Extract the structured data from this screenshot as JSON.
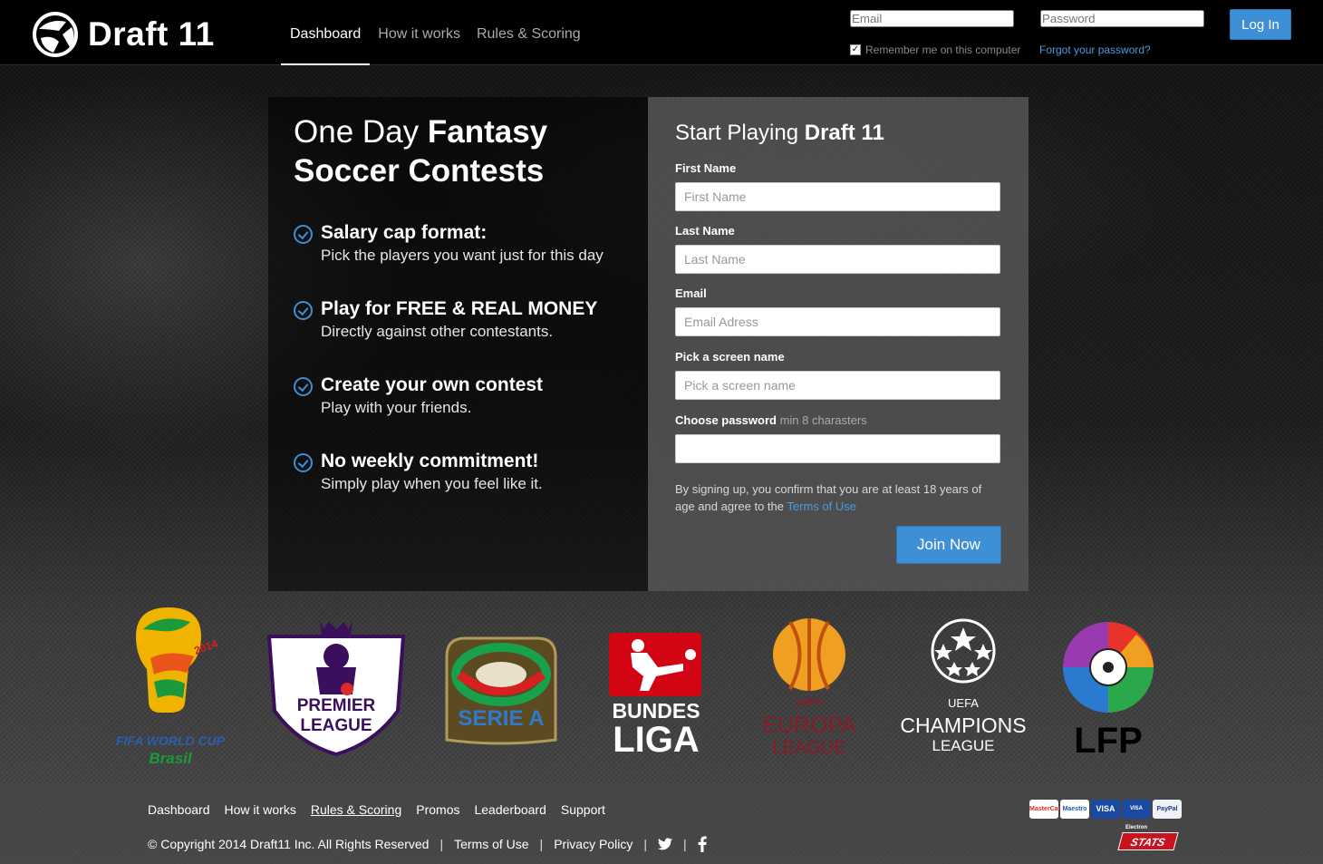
{
  "header": {
    "brand": "Draft 11",
    "nav": [
      {
        "label": "Dashboard",
        "active": true
      },
      {
        "label": "How it works",
        "active": false
      },
      {
        "label": "Rules & Scoring",
        "active": false
      }
    ],
    "login": {
      "email_placeholder": "Email",
      "password_placeholder": "Password",
      "remember_label": "Remember me on this computer",
      "forgot_label": "Forgot your password?",
      "login_label": "Log In"
    }
  },
  "hero": {
    "headline_normal_1": "One Day",
    "headline_bold_1": "Fantasy",
    "headline_bold_2": "Soccer Contests",
    "features": [
      {
        "title": "Salary cap format:",
        "desc": "Pick the players you want just for this day"
      },
      {
        "title": "Play for FREE & REAL MONEY",
        "desc": "Directly against other contestants."
      },
      {
        "title": "Create your own contest",
        "desc": "Play with your friends."
      },
      {
        "title": "No weekly commitment!",
        "desc": "Simply play when you feel like it."
      }
    ]
  },
  "signup": {
    "title_normal": "Start Playing",
    "title_bold": "Draft 11",
    "fields": [
      {
        "label": "First Name",
        "placeholder": "First Name"
      },
      {
        "label": "Last Name",
        "placeholder": "Last Name"
      },
      {
        "label": "Email",
        "placeholder": "Email Adress"
      },
      {
        "label": "Pick a screen name",
        "placeholder": "Pick a screen name"
      },
      {
        "label": "Choose password",
        "hint": "min 8 charasters",
        "placeholder": ""
      }
    ],
    "terms_text": "By signing up, you confirm that you are at least 18 years of age and agree to the",
    "terms_link": "Terms of Use",
    "join_label": "Join Now"
  },
  "leagues": {
    "wc_line1": "FIFA WORLD CUP",
    "wc_line2": "Brasil",
    "wc_year": "2014",
    "pl_line1": "PREMIER",
    "pl_line2": "LEAGUE",
    "seriea": "SERIE A",
    "bl_line1": "BUNDES",
    "bl_line2": "LIGA",
    "el_uefa": "UEFA",
    "el_line1": "EUROPA",
    "el_line2": "LEAGUE",
    "cl_uefa": "UEFA",
    "cl_line1": "CHAMPIONS",
    "cl_line2": "LEAGUE",
    "lfp": "LFP"
  },
  "footer": {
    "nav": [
      "Dashboard",
      "How it works",
      "Rules & Scoring",
      "Promos",
      "Leaderboard",
      "Support"
    ],
    "copyright": "© Copyright 2014 Draft11 Inc. All Rights Reserved",
    "terms": "Terms of Use",
    "privacy": "Privacy Policy",
    "twitter_icon": "twitter-icon",
    "facebook_icon": "facebook-icon",
    "cards": [
      "MasterCard",
      "Maestro",
      "VISA",
      "VISA Electron",
      "PayPal"
    ],
    "stats": "STATS"
  },
  "colors": {
    "accent": "#3f8fd6",
    "link": "#4a9be0",
    "header_bg": "#000000"
  }
}
